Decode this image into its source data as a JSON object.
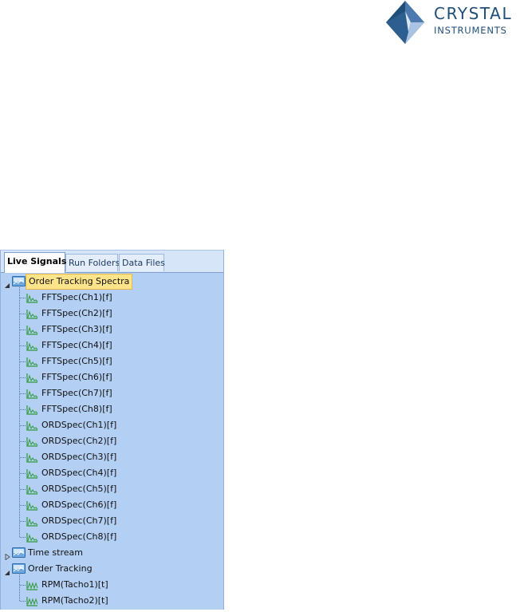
{
  "logo": {
    "word1": "CRYSTAL",
    "word2": "INSTRUMENTS",
    "icon": "crystal-diamond-logo",
    "colors": {
      "dark": "#1f4e79",
      "mid": "#4c7ab0",
      "light": "#a8c4e2"
    }
  },
  "tabs": [
    {
      "label": "Live Signals",
      "active": true
    },
    {
      "label": "Run Folders",
      "active": false
    },
    {
      "label": "Data Files",
      "active": false
    }
  ],
  "tree": {
    "groups": [
      {
        "label": "Order Tracking Spectra",
        "expanded": true,
        "selected": true,
        "icon": "signal-folder-icon",
        "items": [
          "FFTSpec(Ch1)[f]",
          "FFTSpec(Ch2)[f]",
          "FFTSpec(Ch3)[f]",
          "FFTSpec(Ch4)[f]",
          "FFTSpec(Ch5)[f]",
          "FFTSpec(Ch6)[f]",
          "FFTSpec(Ch7)[f]",
          "FFTSpec(Ch8)[f]",
          "ORDSpec(Ch1)[f]",
          "ORDSpec(Ch2)[f]",
          "ORDSpec(Ch3)[f]",
          "ORDSpec(Ch4)[f]",
          "ORDSpec(Ch5)[f]",
          "ORDSpec(Ch6)[f]",
          "ORDSpec(Ch7)[f]",
          "ORDSpec(Ch8)[f]"
        ],
        "item_icon": "spectrum-signal-icon"
      },
      {
        "label": "Time stream",
        "expanded": false,
        "selected": false,
        "icon": "signal-folder-icon",
        "items": []
      },
      {
        "label": "Order Tracking",
        "expanded": true,
        "selected": false,
        "icon": "signal-folder-icon",
        "items": [
          "RPM(Tacho1)[t]",
          "RPM(Tacho2)[t]"
        ],
        "item_icon": "time-signal-icon"
      }
    ]
  },
  "colors": {
    "panel_bg": "#b3cff3",
    "selection_bg": "#fde48b",
    "signal_icon_green": "#2e9a3a"
  }
}
